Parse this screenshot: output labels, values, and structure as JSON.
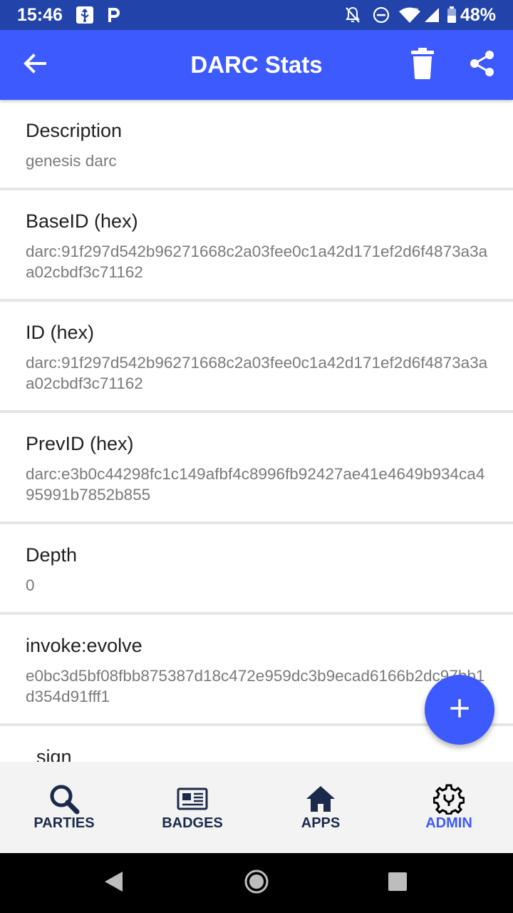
{
  "status_bar": {
    "time": "15:46",
    "battery": "48%",
    "icons": [
      "usb-icon",
      "parking-icon",
      "bell-off-icon",
      "do-not-disturb-icon",
      "wifi-icon",
      "signal-icon",
      "battery-icon"
    ]
  },
  "app_bar": {
    "title": "DARC Stats",
    "icons": [
      "back-arrow-icon",
      "trash-icon",
      "share-icon"
    ],
    "color": "#3d5afe"
  },
  "items": [
    {
      "label": "Description",
      "value": "genesis darc"
    },
    {
      "label": "BaseID (hex)",
      "value": "darc:91f297d542b96271668c2a03fee0c1a42d171ef2d6f4873a3aa02cbdf3c71162"
    },
    {
      "label": "ID (hex)",
      "value": "darc:91f297d542b96271668c2a03fee0c1a42d171ef2d6f4873a3aa02cbdf3c71162"
    },
    {
      "label": "PrevID (hex)",
      "value": "darc:e3b0c44298fc1c149afbf4c8996fb92427ae41e4649b934ca495991b7852b855"
    },
    {
      "label": "Depth",
      "value": "0"
    },
    {
      "label": "invoke:evolve",
      "value": "e0bc3d5bf08fbb875387d18c472e959dc3b9ecad6166b2dc97bb1d354d91fff1"
    },
    {
      "label": "_sign",
      "value": ""
    }
  ],
  "fab": {
    "icon": "plus-icon"
  },
  "bottom_nav": {
    "tabs": [
      {
        "label": "PARTIES",
        "icon": "search-icon"
      },
      {
        "label": "BADGES",
        "icon": "newspaper-icon"
      },
      {
        "label": "APPS",
        "icon": "home-icon"
      },
      {
        "label": "ADMIN",
        "icon": "gear-admin-icon"
      }
    ],
    "active": "ADMIN",
    "active_color": "#3d5afe"
  },
  "system_nav": {
    "icons": [
      "back-triangle-icon",
      "home-circle-icon",
      "recents-square-icon"
    ]
  }
}
